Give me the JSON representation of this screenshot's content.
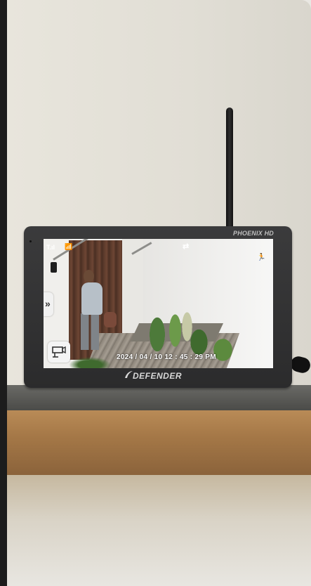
{
  "monitor": {
    "model_label": "PHOENIX HD",
    "brand_label": "DEFENDER"
  },
  "feed": {
    "timestamp": "2024 / 04 / 10  12 : 45 : 29 PM",
    "signal_indicator": "T.ıl"
  },
  "icons": {
    "signal": "signal-bars-icon",
    "antenna": "antenna-icon",
    "cycle": "cycle-icon",
    "motion": "motion-detected-icon",
    "expand": "double-chevron-right-icon",
    "camera_select": "camera-select-icon"
  },
  "colors": {
    "motion_alert": "#e02020",
    "bezel": "#2f2f30",
    "wood": "#a57847"
  }
}
